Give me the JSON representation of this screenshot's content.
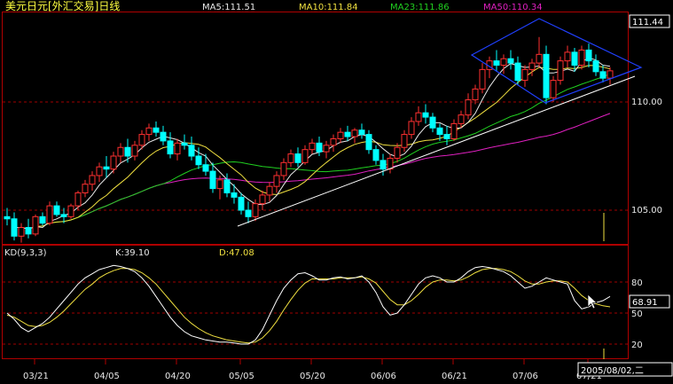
{
  "chart_data": [
    {
      "type": "candlestick",
      "title": "美元日元[外汇交易]日线",
      "indicators": [
        {
          "name": "MA5:111.51",
          "color": "#e8e8e8"
        },
        {
          "name": "MA10:111.84",
          "color": "#f0e040"
        },
        {
          "name": "MA23:111.86",
          "color": "#20d020"
        },
        {
          "name": "MA50:110.34",
          "color": "#e020c0"
        }
      ],
      "y_ticks": [
        "111.44",
        "110.00",
        "105.00"
      ],
      "ylim": [
        102.8,
        115.0
      ],
      "current_label": "111.44",
      "x_ticks": [
        "03/21",
        "04/05",
        "04/20",
        "05/05",
        "05/20",
        "06/06",
        "06/21",
        "07/06",
        "07/21"
      ],
      "date_label": "2005/08/02,二",
      "colors": {
        "up": "#ff3030",
        "down": "#00ffff",
        "grid": "#a00000"
      },
      "ohlc": [
        [
          104.7,
          105.1,
          104.3,
          104.6
        ],
        [
          104.6,
          104.9,
          103.6,
          103.8
        ],
        [
          103.8,
          104.4,
          103.5,
          104.2
        ],
        [
          104.2,
          104.6,
          103.7,
          103.9
        ],
        [
          103.9,
          104.8,
          103.8,
          104.7
        ],
        [
          104.7,
          104.9,
          104.3,
          104.4
        ],
        [
          104.4,
          105.4,
          104.3,
          105.2
        ],
        [
          105.2,
          105.4,
          104.7,
          104.8
        ],
        [
          104.8,
          105.1,
          104.4,
          104.7
        ],
        [
          104.7,
          105.3,
          104.6,
          105.2
        ],
        [
          105.2,
          105.9,
          105.0,
          105.8
        ],
        [
          105.8,
          106.4,
          105.6,
          106.2
        ],
        [
          106.2,
          106.8,
          105.9,
          106.6
        ],
        [
          106.6,
          107.2,
          106.3,
          107.0
        ],
        [
          107.0,
          107.5,
          106.5,
          106.9
        ],
        [
          106.9,
          107.7,
          106.7,
          107.5
        ],
        [
          107.5,
          108.1,
          107.2,
          107.9
        ],
        [
          107.9,
          108.3,
          107.2,
          107.5
        ],
        [
          107.5,
          108.2,
          107.3,
          108.0
        ],
        [
          108.0,
          108.7,
          107.8,
          108.5
        ],
        [
          108.5,
          109.0,
          108.2,
          108.8
        ],
        [
          108.8,
          109.1,
          108.4,
          108.6
        ],
        [
          108.6,
          108.9,
          108.0,
          108.2
        ],
        [
          108.2,
          108.6,
          107.4,
          107.6
        ],
        [
          107.6,
          108.3,
          107.3,
          108.1
        ],
        [
          108.1,
          108.5,
          107.8,
          108.0
        ],
        [
          108.0,
          108.4,
          107.3,
          107.5
        ],
        [
          107.5,
          107.9,
          106.9,
          107.1
        ],
        [
          107.1,
          107.6,
          106.6,
          106.8
        ],
        [
          106.8,
          107.2,
          105.8,
          106.0
        ],
        [
          106.0,
          106.6,
          105.5,
          106.4
        ],
        [
          106.4,
          106.7,
          105.6,
          105.8
        ],
        [
          105.8,
          106.2,
          105.3,
          105.6
        ],
        [
          105.6,
          105.8,
          104.8,
          105.0
        ],
        [
          105.0,
          105.4,
          104.4,
          104.7
        ],
        [
          104.7,
          105.5,
          104.5,
          105.3
        ],
        [
          105.3,
          105.9,
          105.0,
          105.7
        ],
        [
          105.7,
          106.3,
          105.4,
          106.1
        ],
        [
          106.1,
          106.8,
          105.8,
          106.6
        ],
        [
          106.6,
          107.4,
          106.4,
          107.2
        ],
        [
          107.2,
          107.8,
          107.0,
          107.6
        ],
        [
          107.6,
          107.9,
          107.0,
          107.2
        ],
        [
          107.2,
          108.0,
          107.1,
          107.8
        ],
        [
          107.8,
          108.3,
          107.6,
          108.1
        ],
        [
          108.1,
          108.4,
          107.5,
          107.7
        ],
        [
          107.7,
          108.2,
          107.4,
          108.0
        ],
        [
          108.0,
          108.5,
          107.7,
          108.3
        ],
        [
          108.3,
          108.8,
          108.1,
          108.6
        ],
        [
          108.6,
          108.9,
          108.2,
          108.4
        ],
        [
          108.4,
          108.8,
          108.1,
          108.7
        ],
        [
          108.7,
          109.0,
          108.3,
          108.5
        ],
        [
          108.5,
          108.7,
          107.6,
          107.8
        ],
        [
          107.8,
          108.0,
          107.1,
          107.3
        ],
        [
          107.3,
          107.6,
          106.6,
          106.9
        ],
        [
          106.9,
          107.6,
          106.7,
          107.4
        ],
        [
          107.4,
          108.1,
          107.2,
          107.9
        ],
        [
          107.9,
          108.7,
          107.7,
          108.5
        ],
        [
          108.5,
          109.3,
          108.3,
          109.1
        ],
        [
          109.1,
          109.8,
          108.9,
          109.5
        ],
        [
          109.5,
          109.9,
          109.0,
          109.3
        ],
        [
          109.3,
          109.5,
          108.6,
          108.8
        ],
        [
          108.8,
          109.0,
          108.2,
          108.5
        ],
        [
          108.5,
          108.9,
          108.0,
          108.3
        ],
        [
          108.3,
          109.2,
          108.2,
          109.0
        ],
        [
          109.0,
          109.6,
          108.8,
          109.4
        ],
        [
          109.4,
          110.4,
          109.2,
          110.1
        ],
        [
          110.1,
          110.8,
          109.9,
          110.6
        ],
        [
          110.6,
          111.8,
          110.4,
          111.5
        ],
        [
          111.5,
          112.1,
          111.1,
          111.9
        ],
        [
          111.9,
          112.4,
          111.4,
          111.7
        ],
        [
          111.7,
          112.2,
          111.3,
          112.0
        ],
        [
          112.0,
          112.4,
          111.5,
          111.8
        ],
        [
          111.8,
          112.1,
          110.8,
          111.0
        ],
        [
          111.0,
          111.7,
          110.7,
          111.5
        ],
        [
          111.5,
          112.0,
          111.2,
          111.8
        ],
        [
          111.8,
          113.0,
          111.6,
          112.2
        ],
        [
          112.2,
          112.6,
          109.9,
          110.2
        ],
        [
          110.2,
          111.2,
          110.0,
          111.0
        ],
        [
          111.0,
          112.1,
          110.8,
          111.9
        ],
        [
          111.9,
          112.6,
          111.6,
          112.3
        ],
        [
          112.3,
          112.5,
          111.4,
          111.7
        ],
        [
          111.7,
          112.6,
          111.5,
          112.4
        ],
        [
          112.4,
          112.7,
          111.6,
          111.9
        ],
        [
          111.9,
          112.2,
          111.2,
          111.4
        ],
        [
          111.4,
          111.7,
          110.9,
          111.1
        ],
        [
          111.1,
          111.6,
          110.8,
          111.44
        ]
      ]
    },
    {
      "type": "line",
      "title": "KD(9,3,3)",
      "values_text": [
        "K:39.10",
        "D:47.08"
      ],
      "y_ticks": [
        "80",
        "50",
        "20"
      ],
      "ylim": [
        0,
        100
      ],
      "current_label": "68.91",
      "series": [
        {
          "name": "K",
          "color": "#ffffff",
          "values": [
            50,
            44,
            36,
            32,
            36,
            40,
            46,
            54,
            62,
            70,
            78,
            84,
            88,
            92,
            94,
            96,
            95,
            93,
            90,
            84,
            76,
            66,
            56,
            46,
            38,
            32,
            28,
            26,
            24,
            23,
            22,
            22,
            21,
            20,
            20,
            24,
            34,
            48,
            62,
            74,
            82,
            88,
            89,
            86,
            82,
            82,
            84,
            85,
            83,
            84,
            86,
            80,
            70,
            56,
            48,
            50,
            58,
            68,
            78,
            84,
            86,
            84,
            80,
            80,
            84,
            90,
            94,
            95,
            94,
            92,
            90,
            86,
            80,
            74,
            76,
            80,
            84,
            82,
            80,
            78,
            62,
            54,
            56,
            60,
            62,
            66
          ]
        },
        {
          "name": "D",
          "color": "#f0e040",
          "values": [
            48,
            46,
            42,
            38,
            37,
            38,
            41,
            46,
            52,
            59,
            66,
            73,
            78,
            84,
            88,
            91,
            93,
            93,
            92,
            89,
            84,
            78,
            70,
            62,
            54,
            46,
            40,
            35,
            31,
            28,
            26,
            24,
            23,
            22,
            21,
            22,
            26,
            33,
            42,
            53,
            63,
            72,
            79,
            83,
            83,
            83,
            83,
            84,
            84,
            84,
            85,
            83,
            79,
            71,
            63,
            58,
            58,
            62,
            68,
            75,
            80,
            82,
            82,
            81,
            82,
            85,
            89,
            92,
            93,
            93,
            92,
            90,
            86,
            81,
            78,
            78,
            80,
            81,
            81,
            80,
            74,
            67,
            62,
            59,
            57,
            56
          ]
        }
      ]
    }
  ]
}
